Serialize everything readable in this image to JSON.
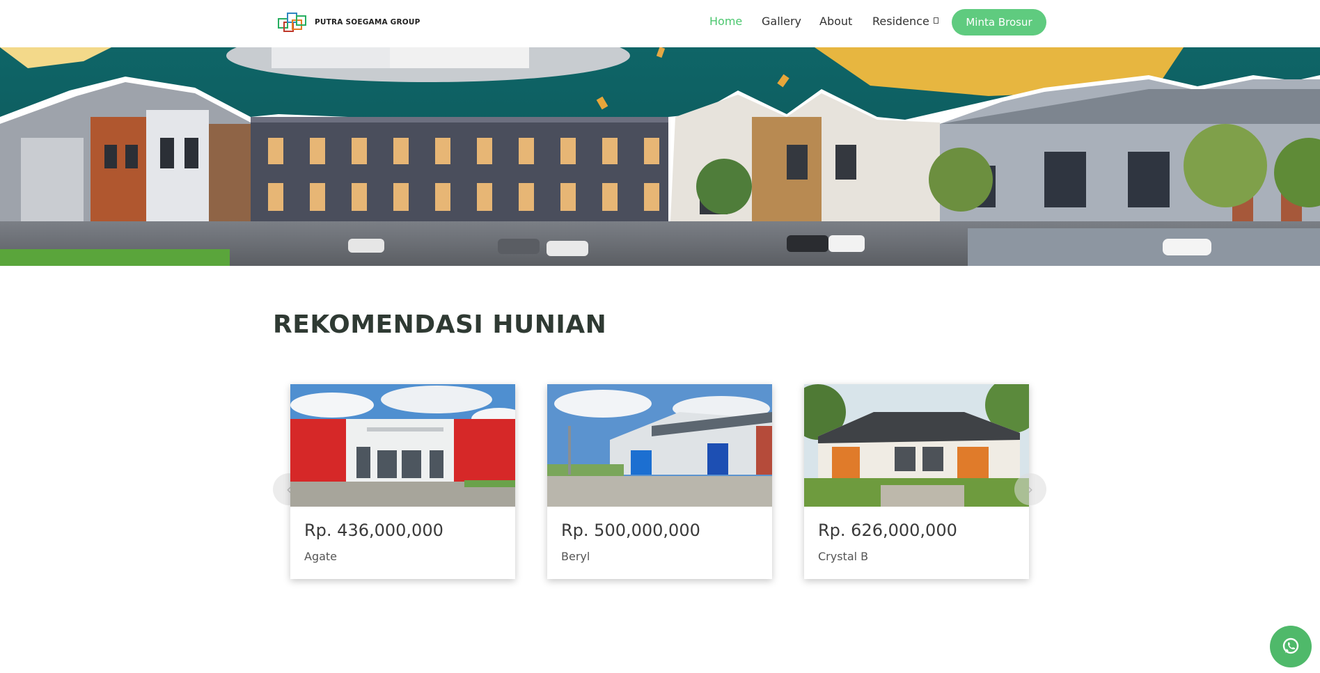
{
  "brand": {
    "name": "PUTRA SOEGAMA GROUP"
  },
  "nav": {
    "items": [
      {
        "label": "Home",
        "active": true
      },
      {
        "label": "Gallery",
        "active": false
      },
      {
        "label": "About",
        "active": false
      },
      {
        "label": "Residence",
        "active": false
      }
    ],
    "cta_label": "Minta Brosur"
  },
  "section": {
    "title": "REKOMENDASI HUNIAN"
  },
  "cards": [
    {
      "price": "Rp. 436,000,000",
      "name": "Agate"
    },
    {
      "price": "Rp. 500,000,000",
      "name": "Beryl"
    },
    {
      "price": "Rp. 626,000,000",
      "name": "Crystal B"
    }
  ],
  "colors": {
    "accent": "#5fcb7f",
    "active_link": "#4cc76f",
    "title": "#2f3a33",
    "whatsapp": "#4fb96a"
  },
  "icons": {
    "carousel_prev": "chevron-left-icon",
    "carousel_next": "chevron-right-icon",
    "whatsapp": "whatsapp-icon",
    "dropdown": "chevron-down-icon"
  }
}
